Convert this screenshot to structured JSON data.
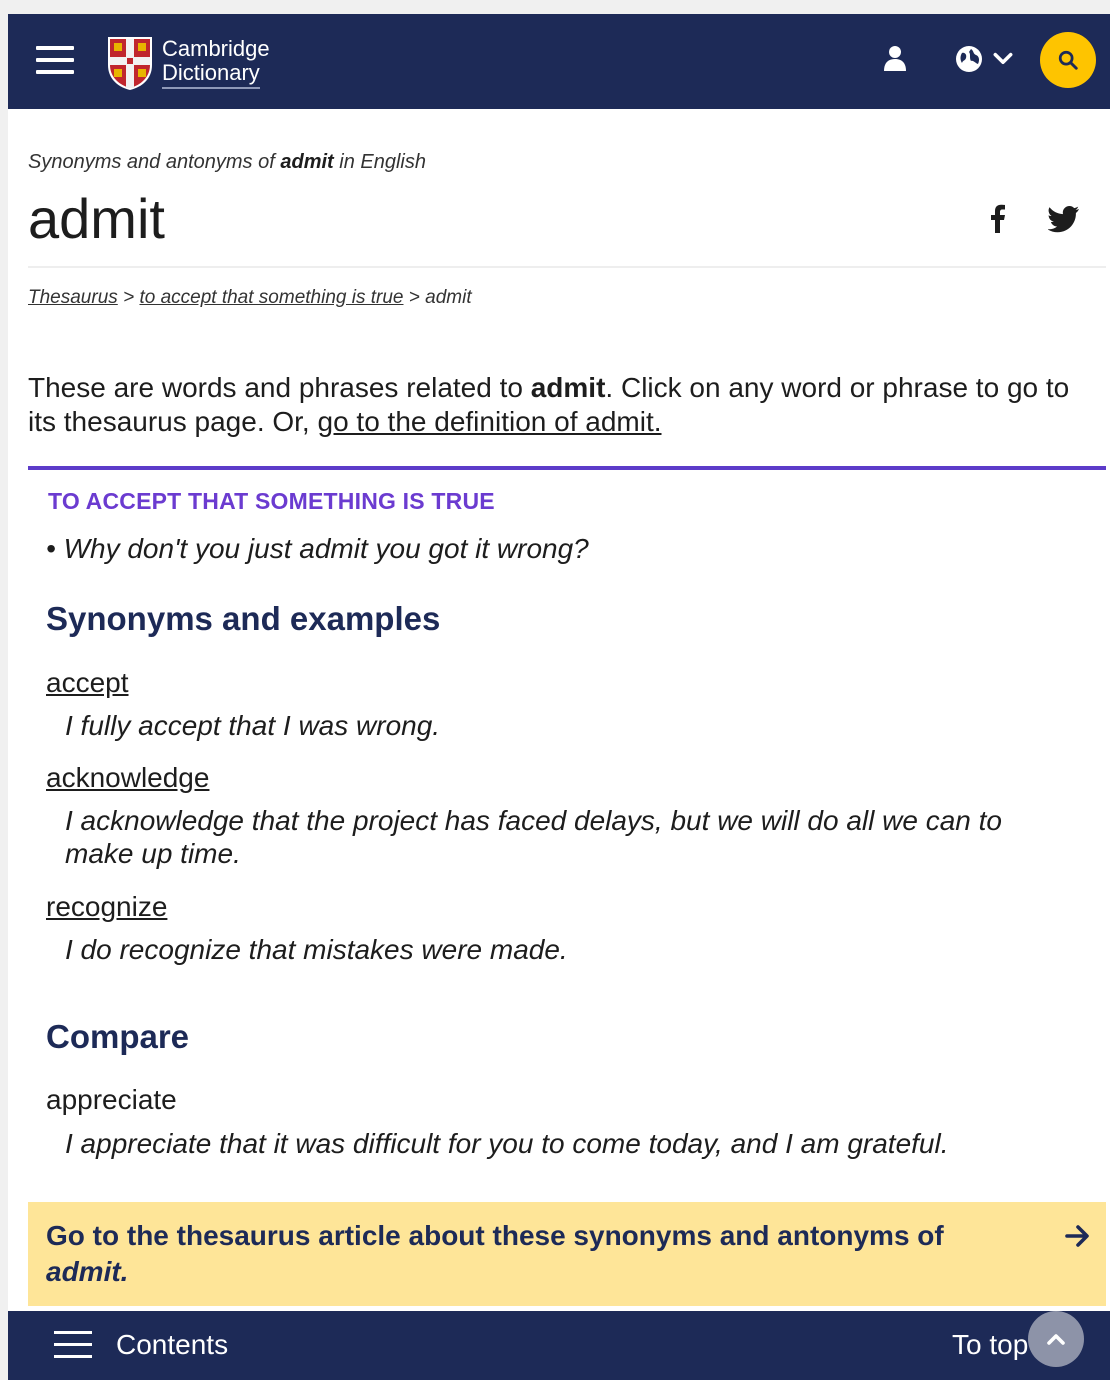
{
  "header": {
    "logo_line1": "Cambridge",
    "logo_line2": "Dictionary",
    "icons": [
      "menu-icon",
      "user-icon",
      "globe-icon",
      "chevron-down-icon",
      "search-icon"
    ]
  },
  "entry": {
    "subhead_prefix": "Synonyms and antonyms of ",
    "subhead_word": "admit",
    "subhead_suffix": " in English",
    "headword": "admit"
  },
  "breadcrumb": {
    "items": [
      "Thesaurus",
      "to accept that something is true",
      "admit"
    ],
    "separator": ">"
  },
  "intro": {
    "part1": "These are words and phrases related to ",
    "word": "admit",
    "part2": ". Click on any word or phrase to go to its thesaurus page. Or, ",
    "link": "go to the definition of admit."
  },
  "sense": {
    "title": "TO ACCEPT THAT SOMETHING IS TRUE",
    "example": "• Why don't you just admit you got it wrong?"
  },
  "synonyms": {
    "heading": "Synonyms and examples",
    "items": [
      {
        "word": "accept",
        "example": "I fully accept that I was wrong."
      },
      {
        "word": "acknowledge",
        "example": "I acknowledge that the project has faced delays, but we will do all we can to make up time."
      },
      {
        "word": "recognize",
        "example": "I do recognize that mistakes were made."
      }
    ]
  },
  "compare": {
    "heading": "Compare",
    "items": [
      {
        "word": "appreciate",
        "example": "I appreciate that it was difficult for you to come today, and I am grateful."
      }
    ]
  },
  "cta": {
    "text": "Go to the thesaurus article about these synonyms and antonyms of ",
    "word": "admit."
  },
  "footer": {
    "contents_label": "Contents",
    "totop_label": "To top"
  },
  "colors": {
    "navy": "#1d2a57",
    "accent_purple": "#5c3bc9",
    "search_yellow": "#fec400",
    "cta_yellow": "#fee598"
  }
}
